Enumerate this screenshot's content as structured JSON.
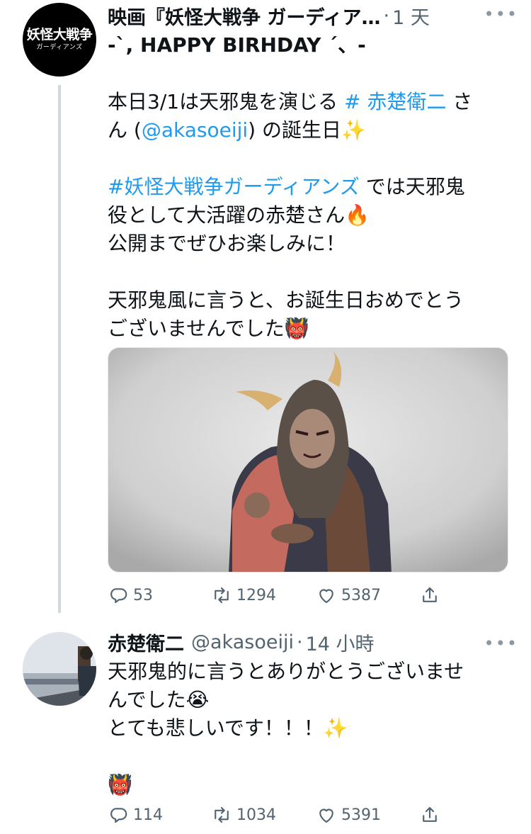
{
  "tweets": [
    {
      "author": "映画『妖怪大戦争 ガーディア…",
      "handle": "",
      "dot": "·",
      "time": "1 天",
      "avatar_logo": {
        "main": "妖怪大戦争",
        "sub": "ガーディアンズ"
      },
      "body": {
        "line1": "-`, HAPPY BIRHDAY ´、-",
        "line2_a": "本日3/1は天邪鬼を演じる ",
        "line2_link": "# 赤楚衛二",
        "line2_b": " さ",
        "line3_a": "ん (",
        "line3_link": "@akasoeiji",
        "line3_b": ") の誕生日✨",
        "line4_link": "#妖怪大戦争ガーディアンズ",
        "line4_b": " では天邪鬼",
        "line5": "役として大活躍の赤楚さん🔥",
        "line6": "公開までぜひお楽しみに！",
        "line7": "天邪鬼風に言うと、お誕生日おめでとう",
        "line8": "ございませんでした👹"
      },
      "stats": {
        "replies": "53",
        "retweets": "1294",
        "likes": "5387"
      }
    },
    {
      "author": "赤楚衛二",
      "handle": "@akasoeiji",
      "dot": "·",
      "time": "14 小時",
      "body": {
        "line1": "天邪鬼的に言うとありがとうございませ",
        "line2": "んでした😭",
        "line3": "とても悲しいです！！！✨",
        "line4": "👹"
      },
      "stats": {
        "replies": "114",
        "retweets": "1034",
        "likes": "5391"
      }
    }
  ],
  "colors": {
    "link": "#1d9bf0",
    "secondary_text": "#536471",
    "thread_line": "#cfd9de"
  },
  "icons": [
    "more-icon",
    "reply-icon",
    "retweet-icon",
    "like-icon",
    "share-icon"
  ]
}
